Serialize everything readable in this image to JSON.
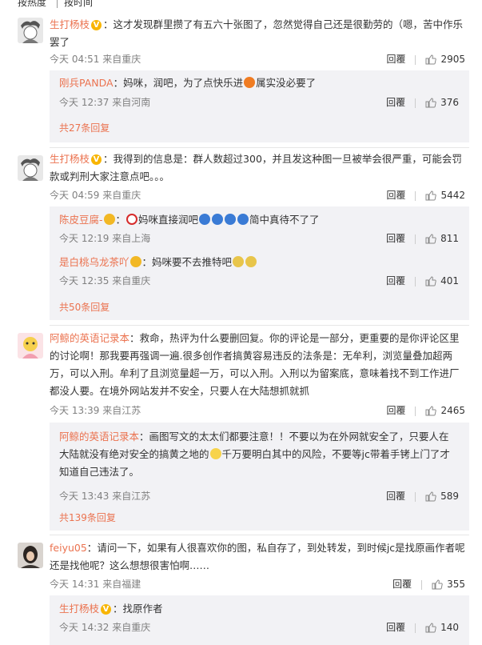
{
  "sort_bar": {
    "hot": "按热度",
    "time": "按时间"
  },
  "comments": [
    {
      "user": "生打杨枝",
      "text": "这才发现群里攒了有五六十张图了，忽然觉得自己还是很勤劳的（嗯，苦中作乐罢了",
      "time": "今天 04:51 来自重庆",
      "reply": "回覆",
      "likes": "2905",
      "replies": [
        {
          "user": "刚兵PANDA",
          "text_before": "妈咪，润吧，为了点快乐进",
          "text_after": "属实没必要了",
          "time": "今天 12:37 来自河南",
          "reply": "回覆",
          "likes": "376"
        }
      ],
      "more": "共27条回复"
    },
    {
      "user": "生打杨枝",
      "text": "我得到的信息是：群人数超过300，并且发这种图一旦被举会很严重，可能会罚款或判刑大家注意点吧。。。",
      "time": "今天 04:59 来自重庆",
      "reply": "回覆",
      "likes": "5442",
      "replies": [
        {
          "user": "陈皮豆腐-",
          "text_before": "妈咪直接润吧",
          "text_after": "简中真待不了了",
          "time": "今天 12:19 来自上海",
          "reply": "回覆",
          "likes": "811"
        },
        {
          "user": "是白桃乌龙茶吖",
          "text_before": "妈咪要不去推特吧",
          "text_after": "",
          "time": "今天 12:35 来自重庆",
          "reply": "回覆",
          "likes": "401"
        }
      ],
      "more": "共50条回复"
    },
    {
      "user": "阿鲸的英语记录本",
      "text": "救命，热评为什么要删回复。你的评论是一部分，更重要的是你评论区里的讨论啊！那我要再强调一遍.很多创作者搞黄容易违反的法条是：无牟利，浏览量叠加超两万，可以入刑。牟利了且浏览量超一万，可以入刑。入刑以为留案底，意味着找不到工作进厂都没人要。在境外网站发并不安全，只要人在大陆想抓就抓",
      "time": "今天 13:39 来自江苏",
      "reply": "回覆",
      "likes": "2465",
      "replies": [
        {
          "user": "阿鲸的英语记录本",
          "text_before": "画图写文的太太们都要注意！！不要以为在外网就安全了，只要人在大陆就没有绝对安全的搞黄之地的",
          "text_after": "千万要明白其中的风险，不要等jc带着手铐上门了才知道自己违法了。",
          "time": "今天 13:43 来自江苏",
          "reply": "回覆",
          "likes": "589"
        }
      ],
      "more": "共139条回复"
    },
    {
      "user": "feiyu05",
      "text": "请问一下，如果有人很喜欢你的图，私自存了，到处转发，到时候jc是找原画作者呢还是找他呢？这么想想很害怕啊……",
      "time": "今天 14:31 来自福建",
      "reply": "回覆",
      "likes": "355",
      "replies": [
        {
          "user": "生打杨枝",
          "text_before": "找原作者",
          "text_after": "",
          "time": "今天 14:32 来自重庆",
          "reply": "回覆",
          "likes": "140"
        }
      ]
    }
  ],
  "colors": {
    "username": "#eb7350",
    "reply_bg": "#f2f2f5",
    "meta": "#808080",
    "badge": "#f8b500"
  }
}
